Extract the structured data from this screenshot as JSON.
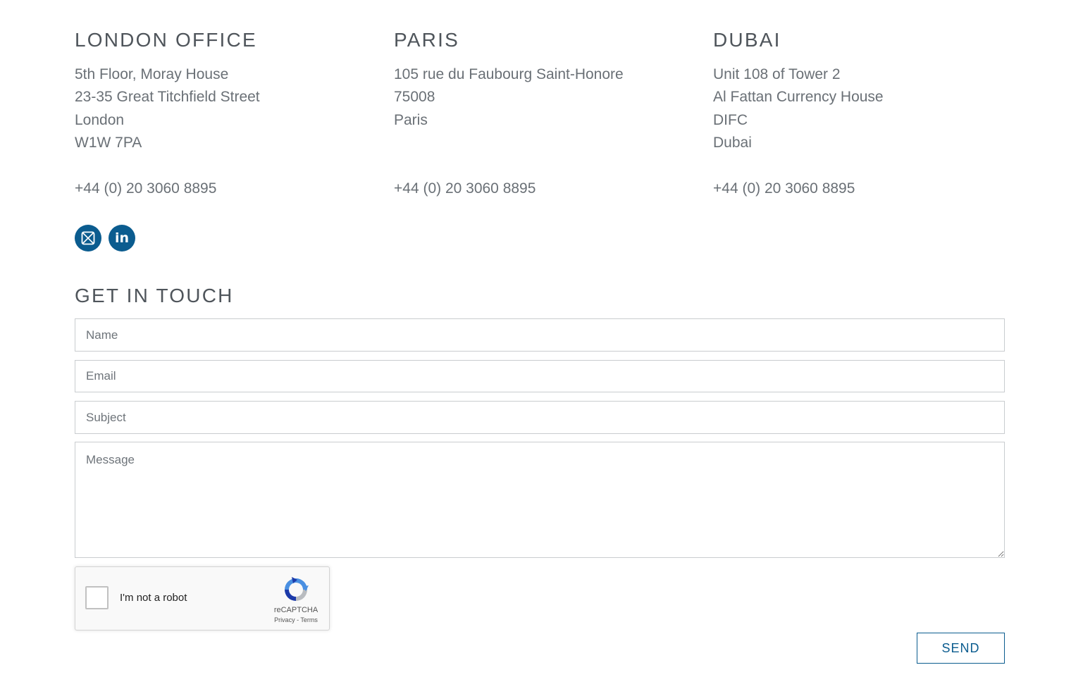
{
  "offices": [
    {
      "title": "LONDON OFFICE",
      "address": [
        "5th Floor, Moray House",
        "23-35 Great Titchfield Street",
        "London",
        "W1W 7PA"
      ],
      "phone": "+44 (0) 20 3060 8895"
    },
    {
      "title": "PARIS",
      "address": [
        "105 rue du Faubourg Saint-Honore",
        "75008",
        "Paris"
      ],
      "phone": "+44 (0) 20 3060 8895"
    },
    {
      "title": "DUBAI",
      "address": [
        "Unit 108 of Tower 2",
        "Al Fattan Currency House",
        "DIFC",
        "Dubai"
      ],
      "phone": "+44 (0) 20 3060 8895"
    }
  ],
  "social": {
    "email_icon": "envelope-icon",
    "linkedin_icon": "linkedin-icon",
    "linkedin_text": "in",
    "color": "#0b5c8f"
  },
  "contact": {
    "title": "GET IN TOUCH",
    "name_placeholder": "Name",
    "email_placeholder": "Email",
    "subject_placeholder": "Subject",
    "message_placeholder": "Message",
    "send_label": "SEND"
  },
  "recaptcha": {
    "label": "I'm not a robot",
    "brand": "reCAPTCHA",
    "privacy": "Privacy",
    "separator": " - ",
    "terms": "Terms"
  }
}
